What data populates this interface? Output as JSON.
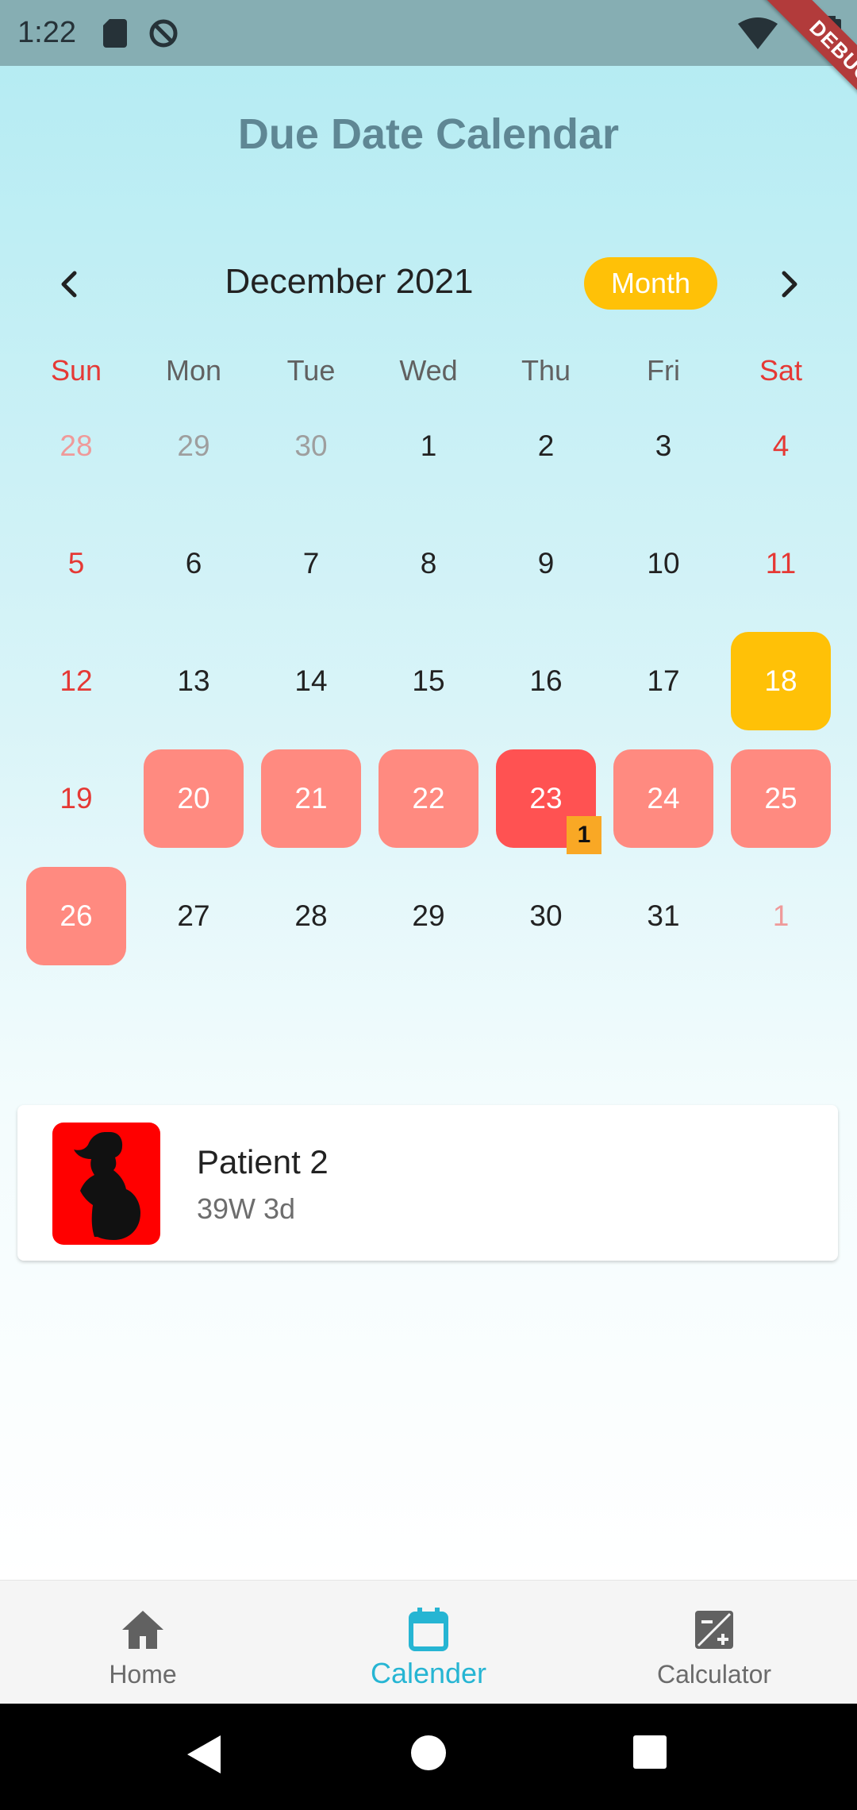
{
  "status_bar": {
    "time": "1:22",
    "debug_label": "DEBUG"
  },
  "header": {
    "title": "Due Date Calendar"
  },
  "calendar": {
    "month_label": "December 2021",
    "format_button": "Month",
    "weekdays": [
      "Sun",
      "Mon",
      "Tue",
      "Wed",
      "Thu",
      "Fri",
      "Sat"
    ],
    "rows": [
      [
        {
          "d": "28",
          "outside": true
        },
        {
          "d": "29",
          "outside": true
        },
        {
          "d": "30",
          "outside": true
        },
        {
          "d": "1"
        },
        {
          "d": "2"
        },
        {
          "d": "3"
        },
        {
          "d": "4"
        }
      ],
      [
        {
          "d": "5"
        },
        {
          "d": "6"
        },
        {
          "d": "7"
        },
        {
          "d": "8"
        },
        {
          "d": "9"
        },
        {
          "d": "10"
        },
        {
          "d": "11"
        }
      ],
      [
        {
          "d": "12"
        },
        {
          "d": "13"
        },
        {
          "d": "14"
        },
        {
          "d": "15"
        },
        {
          "d": "16"
        },
        {
          "d": "17"
        },
        {
          "d": "18",
          "state": "today"
        }
      ],
      [
        {
          "d": "19"
        },
        {
          "d": "20",
          "state": "range"
        },
        {
          "d": "21",
          "state": "range"
        },
        {
          "d": "22",
          "state": "range"
        },
        {
          "d": "23",
          "state": "marked"
        },
        {
          "d": "24",
          "state": "range"
        },
        {
          "d": "25",
          "state": "range"
        }
      ],
      [
        {
          "d": "26",
          "state": "range"
        },
        {
          "d": "27"
        },
        {
          "d": "28"
        },
        {
          "d": "29"
        },
        {
          "d": "30"
        },
        {
          "d": "31"
        },
        {
          "d": "1",
          "outside": true
        }
      ]
    ],
    "event_count": "1",
    "colors": {
      "today": "#ffc107",
      "range": "#ff8a80",
      "marked": "#ff5252",
      "weekend": "#e53935",
      "marker": "#f9a825"
    }
  },
  "event": {
    "title": "Patient 2",
    "subtitle": "39W 3d",
    "icon": "pregnant-woman-silhouette-icon",
    "icon_bg": "#ff0000"
  },
  "bottom_nav": {
    "items": [
      {
        "label": "Home",
        "icon": "home-icon"
      },
      {
        "label": "Calender",
        "icon": "calendar-icon",
        "active": true
      },
      {
        "label": "Calculator",
        "icon": "calculator-icon"
      }
    ],
    "active_color": "#26b5d3"
  }
}
